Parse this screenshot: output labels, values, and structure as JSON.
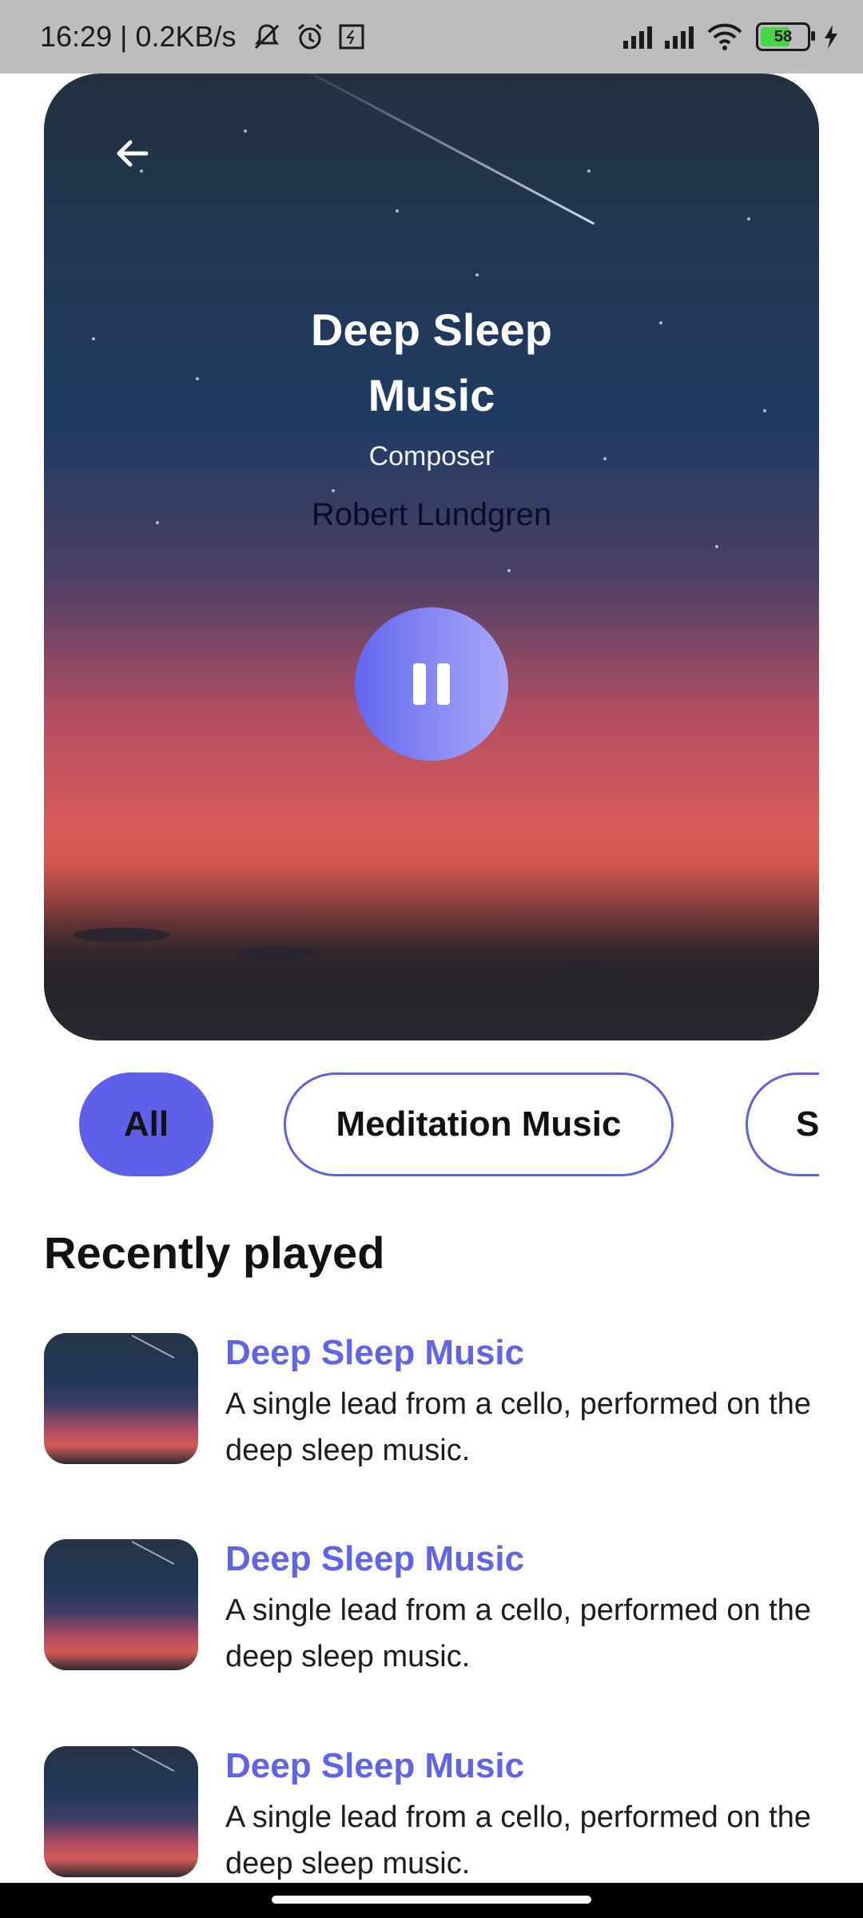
{
  "status_bar": {
    "time_speed": "16:29 | 0.2KB/s",
    "battery": "58"
  },
  "hero": {
    "title_line1": "Deep Sleep",
    "title_line2": "Music",
    "subtitle": "Composer",
    "artist": "Robert Lundgren"
  },
  "filters": {
    "items": [
      {
        "label": "All"
      },
      {
        "label": "Meditation Music"
      },
      {
        "label": "Sp"
      }
    ]
  },
  "recent": {
    "title": "Recently played",
    "items": [
      {
        "title": "Deep Sleep Music",
        "description": "A single lead from a cello, performed on the deep sleep music."
      },
      {
        "title": "Deep Sleep Music",
        "description": "A single lead from a cello, performed on the deep sleep music."
      },
      {
        "title": "Deep Sleep Music",
        "description": "A single lead from a cello, performed on the deep sleep music."
      }
    ]
  },
  "colors": {
    "accent": "#5e60ea",
    "title_accent": "#6163ea"
  },
  "icons": {
    "back": "arrow-left-icon",
    "play": "pause-icon"
  }
}
